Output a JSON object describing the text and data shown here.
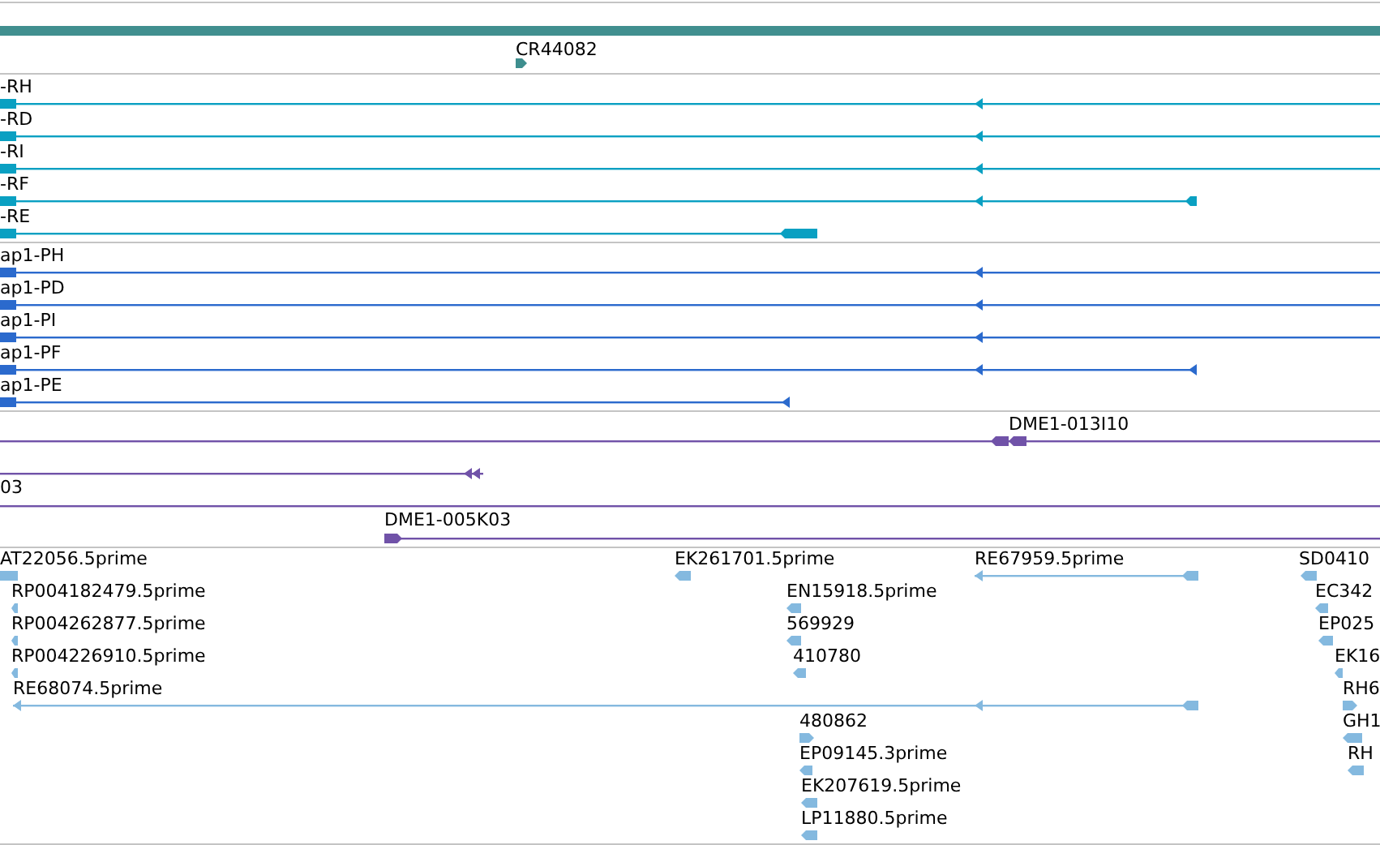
{
  "tracks": [
    {
      "kind": "ncrna",
      "color": "#3e8e8e",
      "features": [
        {
          "label": "CR44082"
        }
      ]
    },
    {
      "kind": "transcript",
      "color": "#0aa0c2",
      "features": [
        {
          "label": "-RH"
        },
        {
          "label": "-RD"
        },
        {
          "label": "-RI"
        },
        {
          "label": "-RF"
        },
        {
          "label": "-RE"
        }
      ]
    },
    {
      "kind": "protein",
      "color": "#2b6acd",
      "features": [
        {
          "label": "ap1-PH"
        },
        {
          "label": "ap1-PD"
        },
        {
          "label": "ap1-PI"
        },
        {
          "label": "ap1-PF"
        },
        {
          "label": "ap1-PE"
        }
      ]
    },
    {
      "kind": "bac",
      "color": "#7052a8",
      "features": [
        {
          "kind": "clone",
          "label": "DME1-013I10"
        },
        {
          "kind": "segment"
        },
        {
          "kind": "clone",
          "label": "03"
        },
        {
          "kind": "clone",
          "label": "DME1-005K03"
        }
      ]
    },
    {
      "kind": "est",
      "color": "#84b9df",
      "features": [
        {
          "label": "AT22056.5prime"
        },
        {
          "label": "EK261701.5prime"
        },
        {
          "label": "RE67959.5prime"
        },
        {
          "label": "SD0410"
        },
        {
          "label": "RP004182479.5prime"
        },
        {
          "label": "EN15918.5prime"
        },
        {
          "label": "EC342"
        },
        {
          "label": "RP004262877.5prime"
        },
        {
          "label": "569929"
        },
        {
          "label": "EP025"
        },
        {
          "label": "RP004226910.5prime"
        },
        {
          "label": "410780"
        },
        {
          "label": "EK16"
        },
        {
          "label": "RE68074.5prime"
        },
        {
          "label": "RH6"
        },
        {
          "label": "480862"
        },
        {
          "label": "GH1"
        },
        {
          "label": "EP09145.3prime"
        },
        {
          "label": "RH"
        },
        {
          "label": "EK207619.5prime"
        },
        {
          "label": "LP11880.5prime"
        }
      ]
    }
  ]
}
